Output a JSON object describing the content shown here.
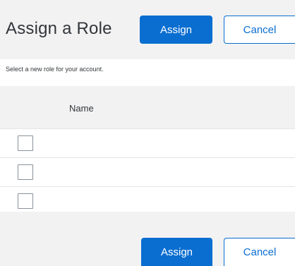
{
  "dialog": {
    "title": "Assign a Role",
    "description": "Select a new role for your account."
  },
  "header": {
    "assign_label": "Assign",
    "cancel_label": "Cancel"
  },
  "table": {
    "columns": [
      "Name"
    ],
    "rows": [
      {
        "checked": false
      },
      {
        "checked": false
      },
      {
        "checked": false
      }
    ]
  },
  "footer": {
    "assign_label": "Assign",
    "cancel_label": "Cancel"
  },
  "colors": {
    "accent": "#0a6ed1",
    "background": "#f2f2f2",
    "text": "#32363a"
  }
}
